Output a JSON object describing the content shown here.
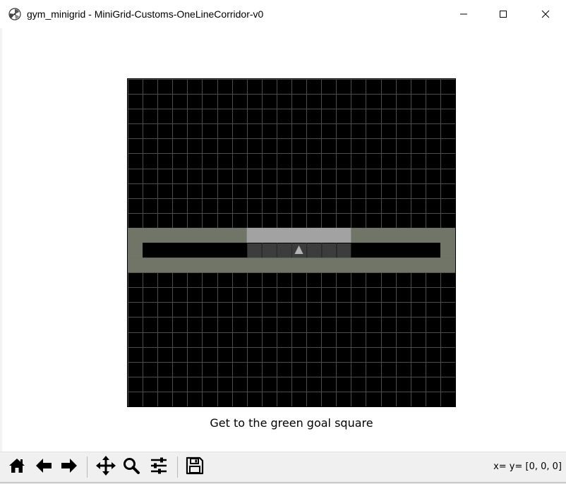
{
  "window": {
    "title": "gym_minigrid - MiniGrid-Customs-OneLineCorridor-v0",
    "app_icon": "matplotlib-logo-icon",
    "controls": [
      "minimize-icon",
      "maximize-icon",
      "close-icon"
    ]
  },
  "environment": {
    "mission": "Get to the green goal square",
    "grid_cells": 22,
    "corridor_row": 11,
    "corridor_first_col": 1,
    "corridor_last_col": 20,
    "visible_cols": [
      8,
      9,
      10,
      11,
      12,
      13,
      14
    ],
    "agent": {
      "col": 11,
      "row": 11,
      "direction": "up",
      "color": "#b4b4b4"
    },
    "colors": {
      "background": "#000000",
      "gridline": "#4d4d4d",
      "wall": "#707568",
      "wall_highlight": "#a2a2a2",
      "floor_highlight": "#3c3c3c"
    }
  },
  "toolbar": {
    "buttons": [
      {
        "name": "home-icon",
        "tooltip": "Reset original view"
      },
      {
        "name": "back-arrow-icon",
        "tooltip": "Back"
      },
      {
        "name": "forward-arrow-icon",
        "tooltip": "Forward"
      },
      {
        "name": "pan-icon",
        "tooltip": "Pan"
      },
      {
        "name": "zoom-icon",
        "tooltip": "Zoom"
      },
      {
        "name": "subplots-config-icon",
        "tooltip": "Configure subplots"
      },
      {
        "name": "save-icon",
        "tooltip": "Save the figure"
      }
    ],
    "coordinate_readout": "x= y= [0, 0, 0]"
  }
}
